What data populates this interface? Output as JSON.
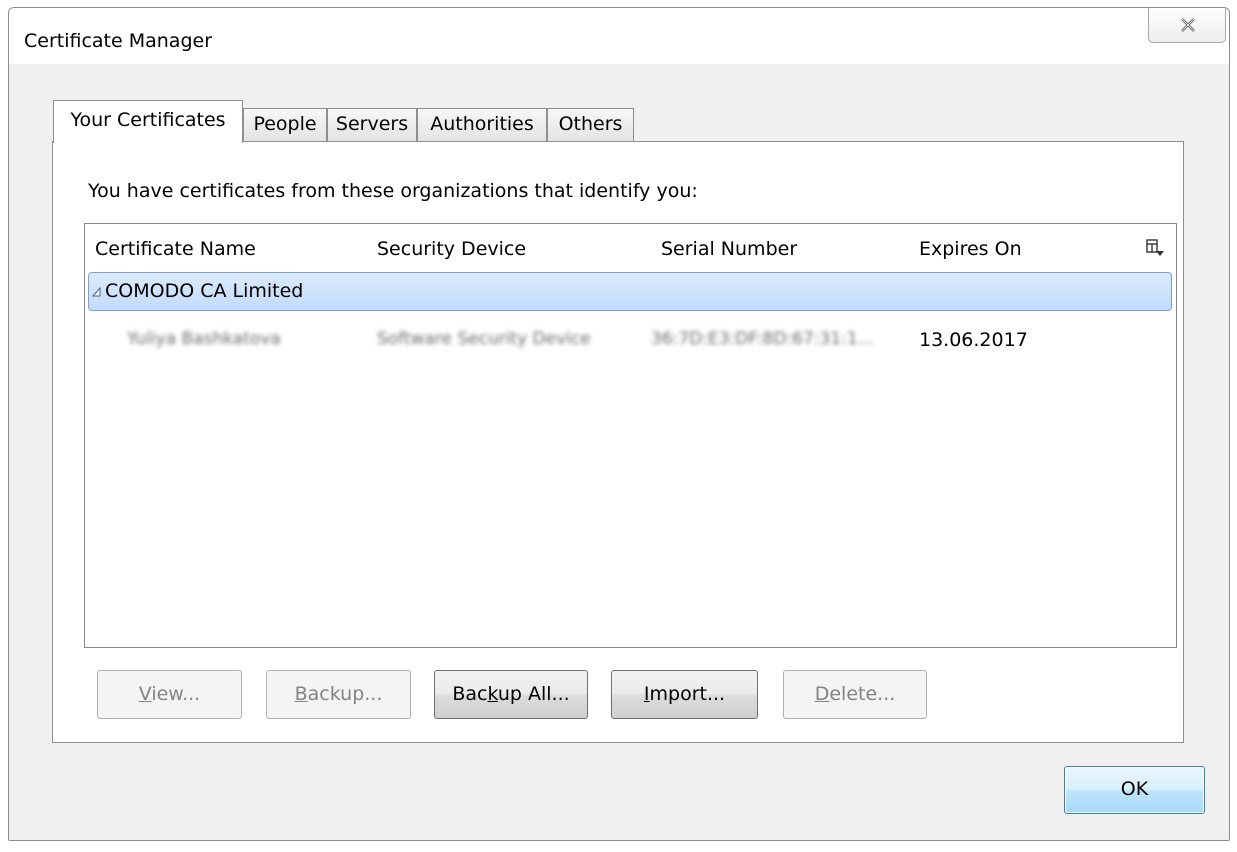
{
  "window": {
    "title": "Certificate Manager",
    "close_icon": "close-icon"
  },
  "tabs": [
    {
      "label": "Your Certificates",
      "active": true
    },
    {
      "label": "People",
      "active": false
    },
    {
      "label": "Servers",
      "active": false
    },
    {
      "label": "Authorities",
      "active": false
    },
    {
      "label": "Others",
      "active": false
    }
  ],
  "panel": {
    "prompt": "You have certificates from these organizations that identify you:"
  },
  "tree": {
    "columns": [
      "Certificate Name",
      "Security Device",
      "Serial Number",
      "Expires On"
    ],
    "column_picker_icon": "column-picker-icon",
    "group": {
      "label": "COMODO CA Limited",
      "expanded": true,
      "selected": true
    },
    "rows": [
      {
        "certificate_name": "Yuliya Bashkatova",
        "security_device": "Software Security Device",
        "serial_number": "36:7D:E3:DF:8D:67:31:1...",
        "expires_on": "13.06.2017"
      }
    ]
  },
  "buttons": {
    "view": {
      "pre": "",
      "key": "V",
      "post": "iew...",
      "enabled": false
    },
    "backup": {
      "pre": "",
      "key": "B",
      "post": "ackup...",
      "enabled": false
    },
    "backup_all": {
      "pre": "Bac",
      "key": "k",
      "post": "up All...",
      "enabled": true
    },
    "import": {
      "pre": "",
      "key": "I",
      "post": "mport...",
      "enabled": true
    },
    "delete": {
      "pre": "",
      "key": "D",
      "post": "elete...",
      "enabled": false
    },
    "ok": "OK"
  },
  "colors": {
    "selection_border": "#7da2ce",
    "selection_fill": "#c1dbfc",
    "default_button_border": "#3c7fb1"
  }
}
